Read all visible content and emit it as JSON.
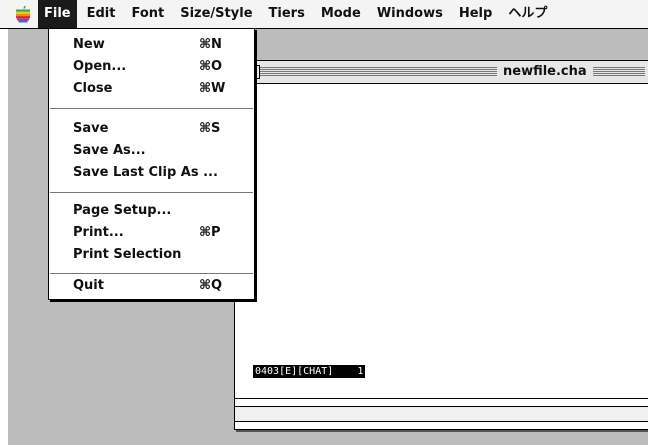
{
  "menubar": {
    "items": [
      "File",
      "Edit",
      "Font",
      "Size/Style",
      "Tiers",
      "Mode",
      "Windows",
      "Help",
      "ヘルプ"
    ]
  },
  "file_menu": {
    "groups": [
      [
        {
          "label": "New",
          "shortcut": "⌘N"
        },
        {
          "label": "Open...",
          "shortcut": "⌘O"
        },
        {
          "label": "Close",
          "shortcut": "⌘W"
        }
      ],
      [
        {
          "label": "Save",
          "shortcut": "⌘S"
        },
        {
          "label": "Save As...",
          "shortcut": ""
        },
        {
          "label": "Save Last Clip As ...",
          "shortcut": ""
        }
      ],
      [
        {
          "label": "Page Setup...",
          "shortcut": ""
        },
        {
          "label": "Print...",
          "shortcut": "⌘P"
        },
        {
          "label": "Print Selection",
          "shortcut": ""
        }
      ],
      [
        {
          "label": "Quit",
          "shortcut": "⌘Q"
        }
      ]
    ]
  },
  "window": {
    "title": "newfile.cha",
    "status_line": "0403[E][CHAT]    1"
  },
  "colors": {
    "menu_highlight": "#1a1a1a",
    "desktop_gray": "#bcbcbc"
  }
}
